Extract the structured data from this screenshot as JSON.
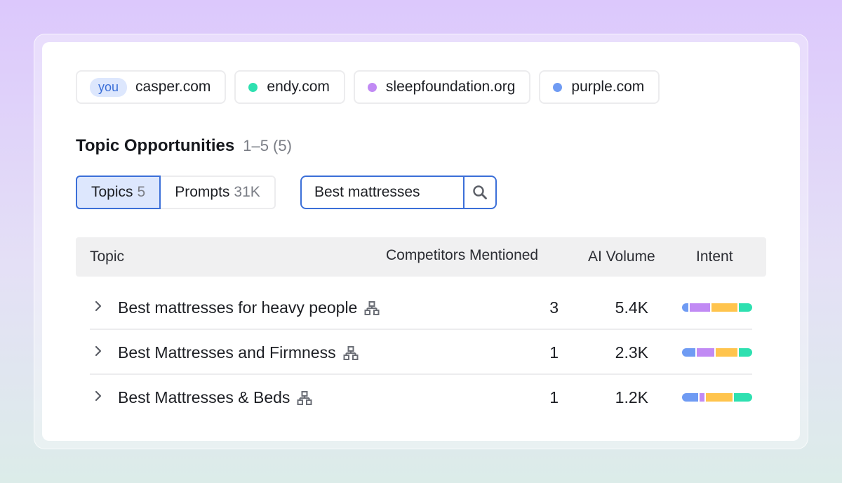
{
  "domains": [
    {
      "badge": "you",
      "name": "casper.com",
      "color": ""
    },
    {
      "badge": "",
      "name": "endy.com",
      "color": "#2ee0b0"
    },
    {
      "badge": "",
      "name": "sleepfoundation.org",
      "color": "#c18af4"
    },
    {
      "badge": "",
      "name": "purple.com",
      "color": "#6f9bf3"
    }
  ],
  "section": {
    "title": "Topic Opportunities",
    "range": "1–5 (5)"
  },
  "tabs": [
    {
      "label": "Topics",
      "count": "5",
      "active": true
    },
    {
      "label": "Prompts",
      "count": "31K",
      "active": false
    }
  ],
  "search": {
    "value": "Best mattresses",
    "icon": "search-icon"
  },
  "table": {
    "headers": {
      "topic": "Topic",
      "competitors": "Competitors Mentioned",
      "volume": "AI Volume",
      "intent": "Intent"
    },
    "rows": [
      {
        "topic": "Best mattresses for heavy people",
        "competitors": "3",
        "volume": "5.4K",
        "intent_share": [
          0.1,
          0.3,
          0.4,
          0.2
        ]
      },
      {
        "topic": "Best Mattresses and Firmness",
        "competitors": "1",
        "volume": "2.3K",
        "intent_share": [
          0.2,
          0.27,
          0.33,
          0.2
        ]
      },
      {
        "topic": "Best Mattresses & Beds",
        "competitors": "1",
        "volume": "1.2K",
        "intent_share": [
          0.24,
          0.08,
          0.4,
          0.28
        ]
      }
    ]
  },
  "intent_colors": [
    "#6f9bf3",
    "#c18af4",
    "#ffc44d",
    "#2ee0b0"
  ]
}
